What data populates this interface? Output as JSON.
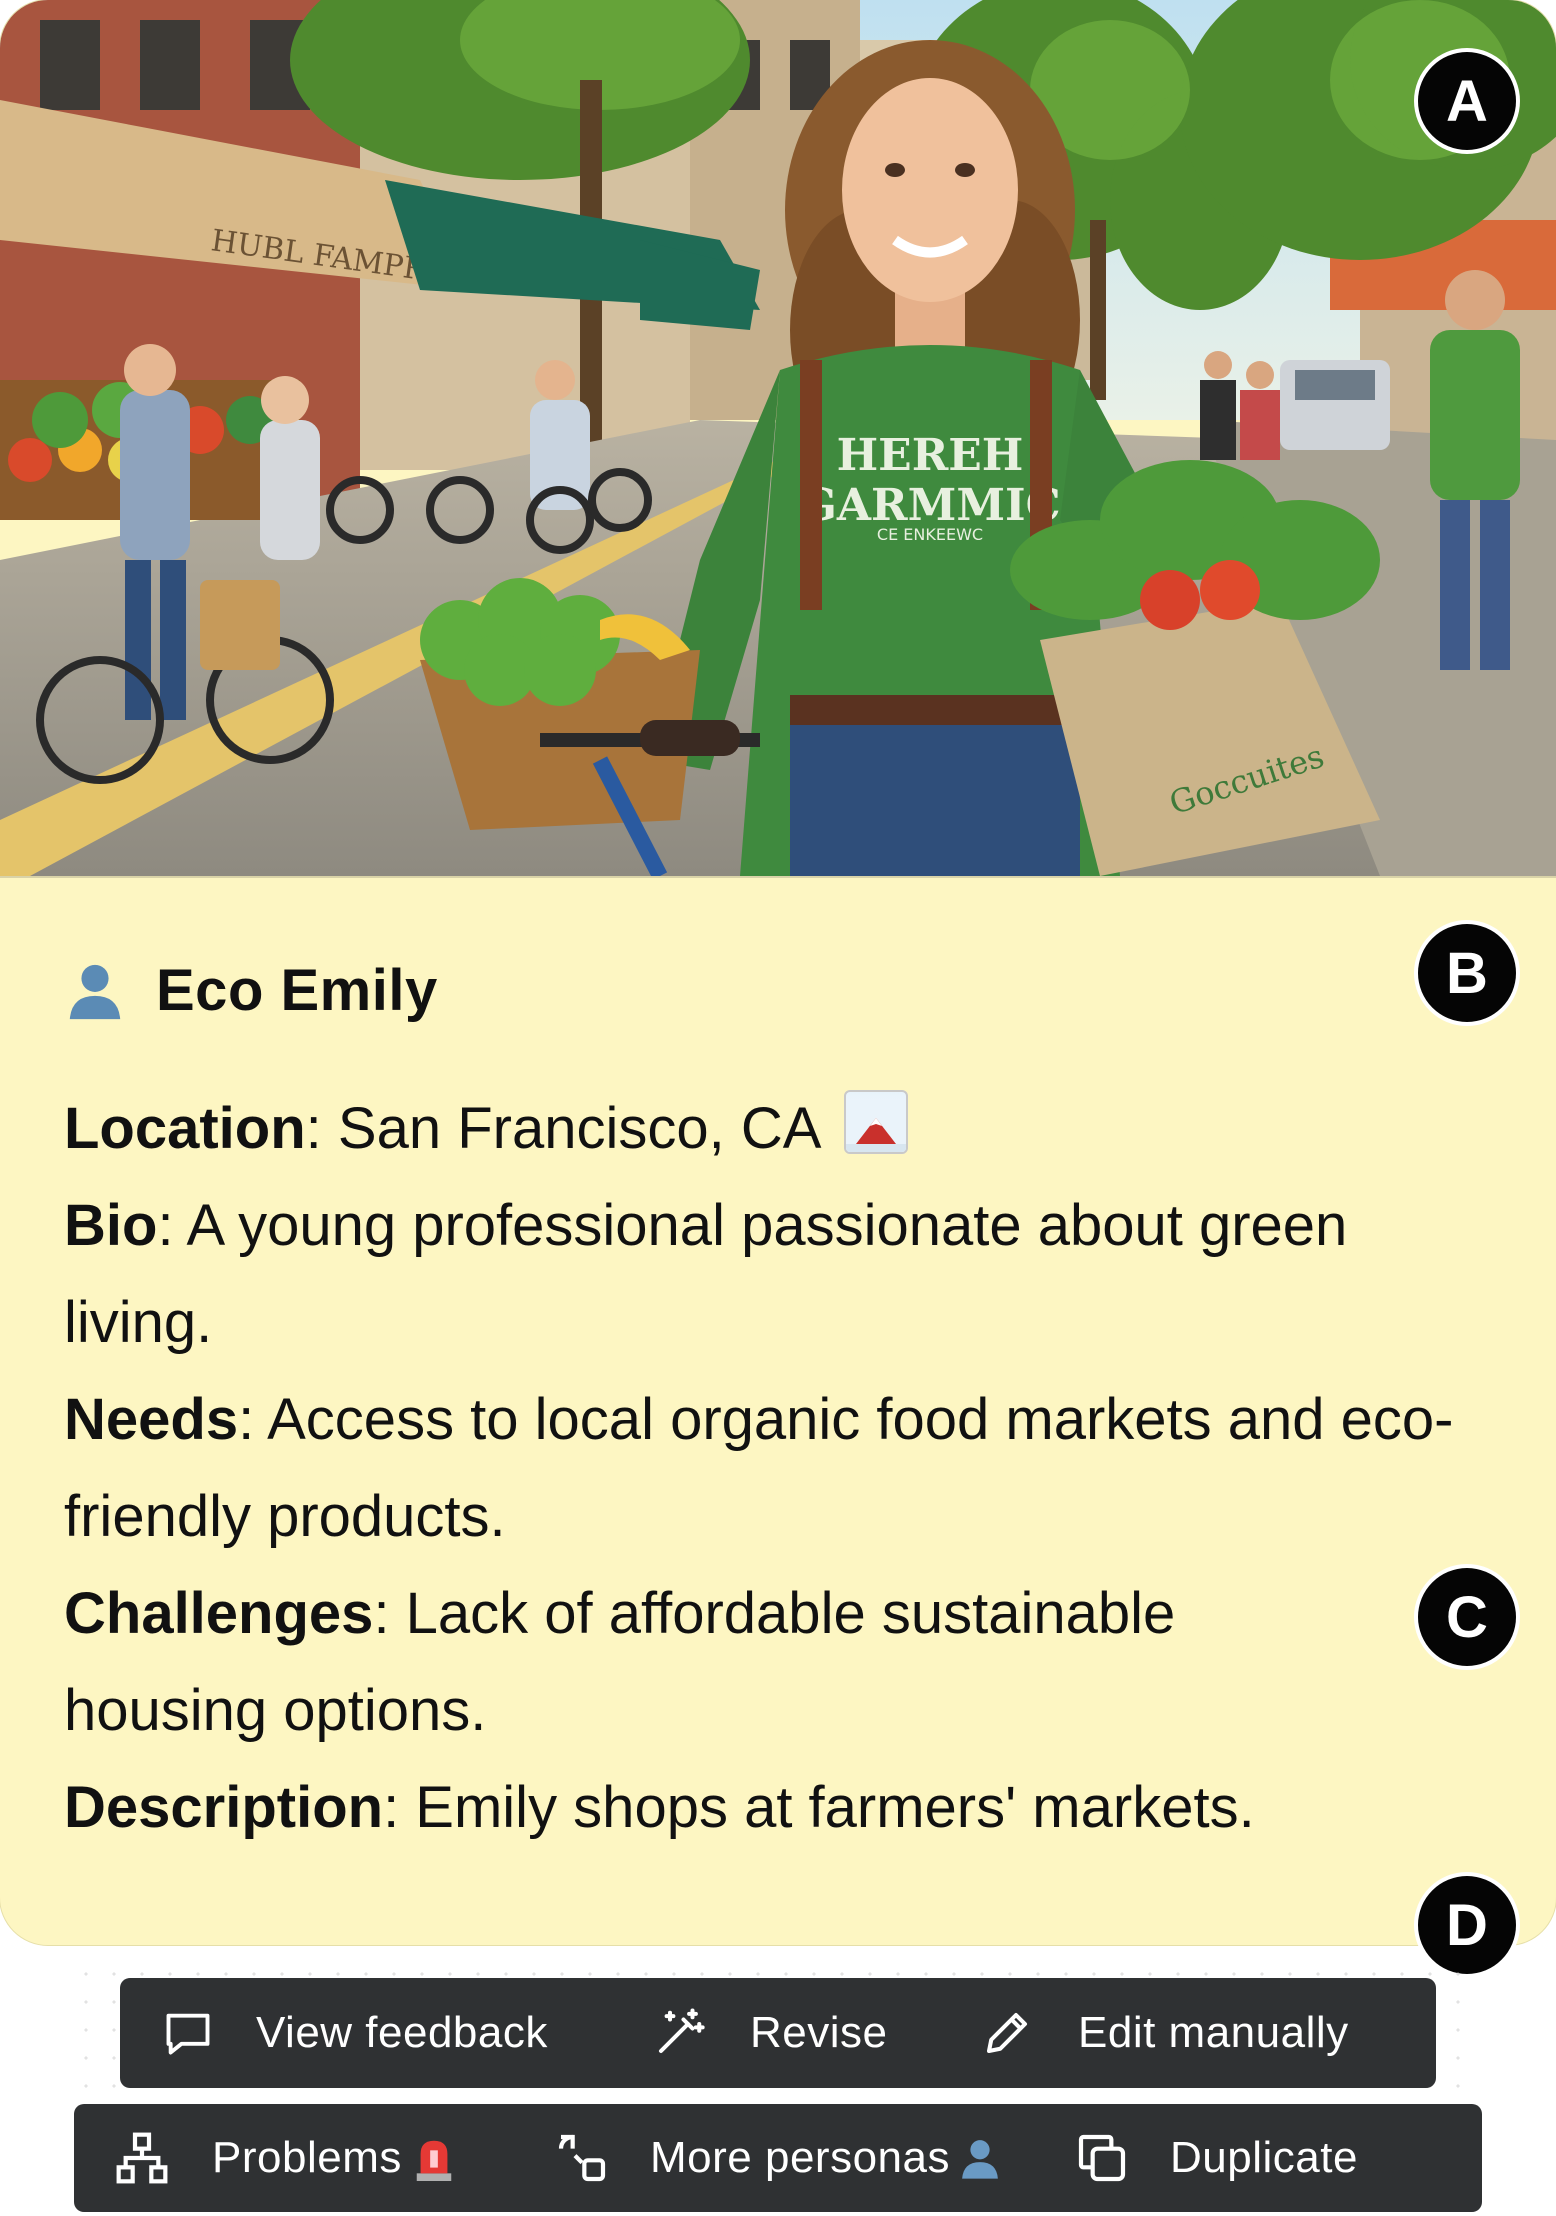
{
  "markers": [
    "A",
    "B",
    "C",
    "D"
  ],
  "persona": {
    "avatar_icon": "person-silhouette-icon",
    "name": "Eco Emily",
    "location_label": "Location",
    "location": "San Francisco, CA",
    "location_icon": "framed-picture-icon",
    "bio_label": "Bio",
    "bio": "A young professional passionate about green living.",
    "needs_label": "Needs",
    "needs": "Access to local organic food markets and eco-friendly products.",
    "challenges_label": "Challenges",
    "challenges": "Lack of affordable sustainable housing options.",
    "description_label": "Description",
    "description": "Emily shops at farmers' markets."
  },
  "toolbar_primary": {
    "view_feedback": "View feedback",
    "revise": "Revise",
    "edit_manually": "Edit manually"
  },
  "toolbar_secondary": {
    "problems": "Problems",
    "more_personas": "More personas",
    "duplicate": "Duplicate"
  },
  "image_text": {
    "shirt_line1": "HEREH",
    "shirt_line2": "GARMMIC",
    "shirt_line3": "CE ENKEEWC",
    "awning_text": "HUBL FAMPRE BEL",
    "bag_text": "Goccuites"
  },
  "colors": {
    "card_bg": "#fdf6c2",
    "toolbar_bg": "#2f3133",
    "marker_bg": "#050505",
    "shirt_green": "#3f8a3e"
  }
}
